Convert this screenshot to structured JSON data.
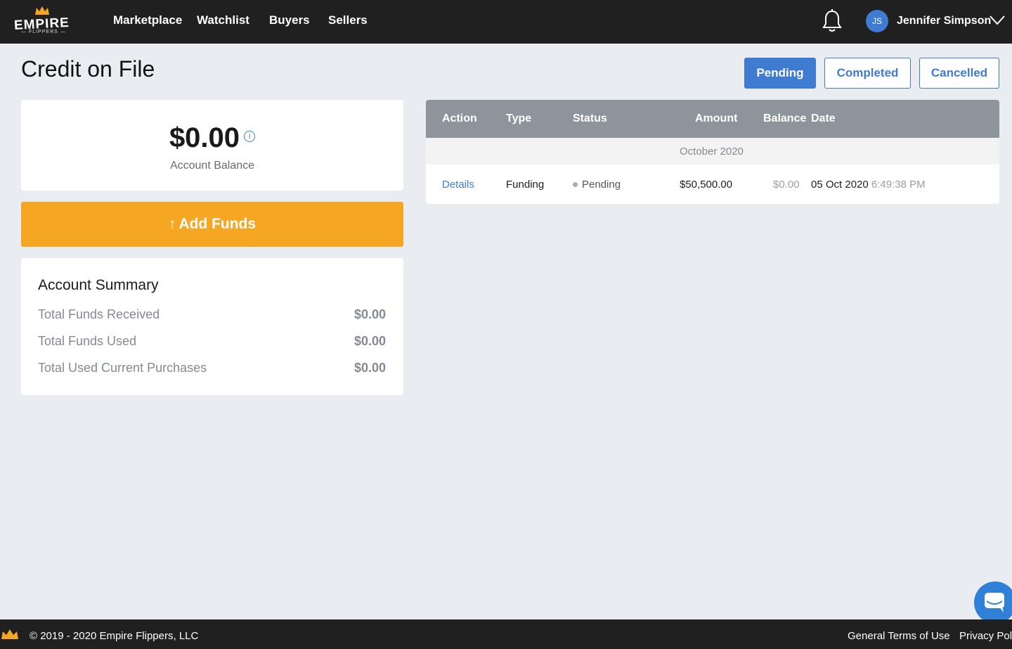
{
  "brand": {
    "name": "EMPIRE",
    "tagline": "— FLIPPERS —",
    "accent": "#f5a623"
  },
  "nav": {
    "links": [
      "Marketplace",
      "Watchlist",
      "Buyers",
      "Sellers"
    ],
    "user_initials": "JS",
    "user_name": "Jennifer Simpson",
    "icons": [
      "bell-icon",
      "chevron-down-icon"
    ]
  },
  "page": {
    "title": "Credit on File",
    "tabs": [
      {
        "label": "Pending",
        "active": true
      },
      {
        "label": "Completed",
        "active": false
      },
      {
        "label": "Cancelled",
        "active": false
      }
    ]
  },
  "balance": {
    "value": "$0.00",
    "label": "Account Balance",
    "info_icon": "i"
  },
  "add_funds": {
    "label": "Add Funds",
    "icon": "↑"
  },
  "summary": {
    "title": "Account Summary",
    "rows": [
      {
        "label": "Total Funds Received",
        "value": "$0.00"
      },
      {
        "label": "Total Funds Used",
        "value": "$0.00"
      },
      {
        "label": "Total Used Current Purchases",
        "value": "$0.00"
      }
    ]
  },
  "table": {
    "headers": [
      "Action",
      "Type",
      "Status",
      "Amount",
      "Balance",
      "Date"
    ],
    "group": "October 2020",
    "rows": [
      {
        "action": "Details",
        "type": "Funding",
        "status": "Pending",
        "amount": "$50,500.00",
        "balance": "$0.00",
        "date": "05 Oct 2020",
        "time": "6:49:38 PM"
      }
    ]
  },
  "footer": {
    "copyright": "© 2019 - 2020 Empire Flippers, LLC",
    "links": [
      "General Terms of Use",
      "Privacy Policy"
    ]
  },
  "colors": {
    "topbar": "#202020",
    "primary": "#3f7bd1",
    "accent": "#f5a623",
    "background": "#e9edf1",
    "table_header": "#8e949b"
  }
}
